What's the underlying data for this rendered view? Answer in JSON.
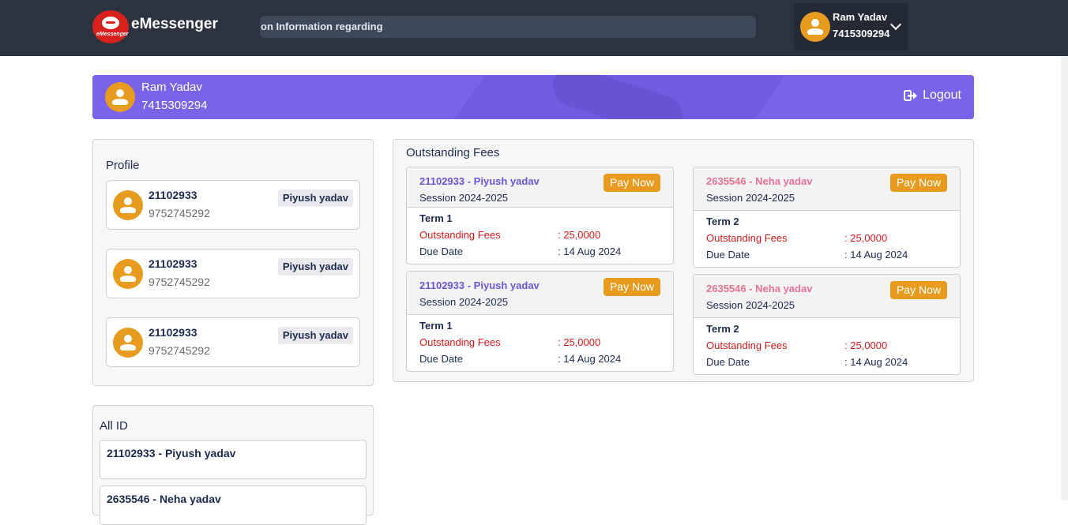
{
  "app": {
    "brand": "eMessenger",
    "logo_text": "eMessenger",
    "logo_icon": "chat-bubble-icon"
  },
  "header": {
    "marquee": "on Information regarding",
    "user": {
      "name": "Ram Yadav",
      "phone": "7415309294"
    }
  },
  "banner": {
    "name": "Ram Yadav",
    "phone": "7415309294",
    "logout_label": "Logout"
  },
  "profile": {
    "title": "Profile",
    "cards": [
      {
        "id": "21102933",
        "phone": "9752745292",
        "tag": "Piyush yadav"
      },
      {
        "id": "21102933",
        "phone": "9752745292",
        "tag": "Piyush yadav"
      },
      {
        "id": "21102933",
        "phone": "9752745292",
        "tag": "Piyush yadav"
      }
    ]
  },
  "all_id": {
    "title": "All ID",
    "items": [
      "21102933 - Piyush yadav",
      "2635546 - Neha yadav"
    ]
  },
  "fees": {
    "title": "Outstanding Fees",
    "pay_label": "Pay Now",
    "outstanding_label": "Outstanding Fees",
    "due_label": "Due Date",
    "cards": [
      {
        "student": "21102933 - Piyush yadav",
        "session": "Session 2024-2025",
        "term": "Term 1",
        "amount": ": 25,0000",
        "due": ": 14 Aug 2024"
      },
      {
        "student": "2635546 - Neha yadav",
        "session": "Session 2024-2025",
        "term": "Term 2",
        "amount": ": 25,0000",
        "due": ": 14 Aug 2024"
      },
      {
        "student": "21102933 - Piyush yadav",
        "session": "Session 2024-2025",
        "term": "Term 1",
        "amount": ": 25,0000",
        "due": ": 14 Aug 2024"
      },
      {
        "student": "2635546 - Neha yadav",
        "session": "Session 2024-2025",
        "term": "Term 2",
        "amount": ": 25,0000",
        "due": ": 14 Aug 2024"
      }
    ]
  },
  "colors": {
    "topbar": "#2b3340",
    "banner": "#7a63e8",
    "accent": "#e89c1f",
    "purple_name": "#6a57d8",
    "pink_name": "#e67393",
    "red": "#d61a1a"
  }
}
